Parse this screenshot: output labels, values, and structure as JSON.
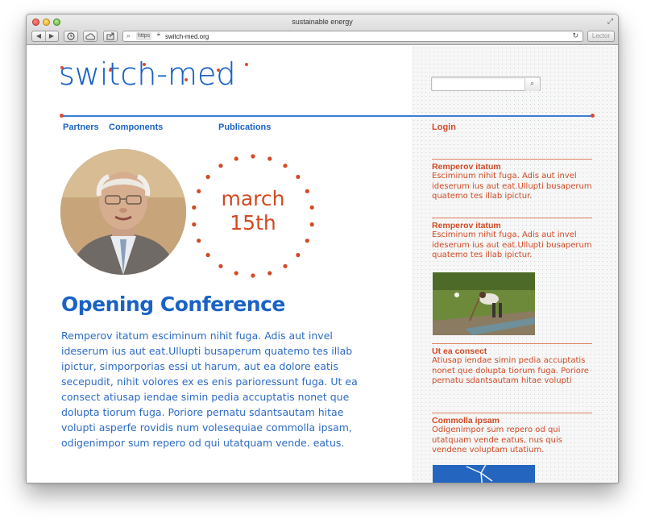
{
  "window": {
    "title": "sustainable energy"
  },
  "toolbar": {
    "back_icon": "back-arrow-icon",
    "forward_icon": "forward-arrow-icon",
    "reader_label": "Lector"
  },
  "address_bar": {
    "protocol": "https",
    "url": "switch-med.org"
  },
  "site": {
    "logo": "switch-med",
    "nav": {
      "partners": "Partners",
      "components": "Components",
      "publications": "Publications"
    },
    "login": "Login",
    "search_placeholder": ""
  },
  "event": {
    "date_line1": "march",
    "date_line2": "15th",
    "title": "Opening Conference",
    "body": "Remperov itatum esciminum nihit fuga. Adis aut invel ideserum ius aut eat.Ullupti busaperum quatemo tes illab ipictur, simporporias essi ut harum, aut ea dolore eatis secepudit, nihit volores ex es enis pariores­sunt fuga. Ut ea consect atiusap iendae simin pedia accuptatis nonet que dolupta tiorum fuga. Poriore pernatu sdantsautam hitae volupti asperfe rovidis num volesequiae commolla ipsam, odigenimpor sum repero od qui utatquam vende. eatus."
  },
  "sidebar": {
    "items": [
      {
        "title": "Remperov itatum",
        "text": "Esciminum nihit fuga. Adis aut invel ideserum ius aut eat.Ullupti busaperum quatemo tes illab ipictur."
      },
      {
        "title": "Remperov itatum",
        "text": "Esciminum nihit fuga. Adis aut invel ideserum ius aut eat.Ullupti busaperum quatemo tes illab ipictur."
      },
      {
        "title": "Ut ea consect",
        "text": "Atiusap iendae simin pedia accuptatis nonet que dolupta tiorum fuga. Poriore pernatu sdantsautam hitae volupti"
      },
      {
        "title": "Commolla ipsam",
        "text": "Odigenimpor sum repero od qui utatquam vende eatus, nus quis vendene voluptam utatium."
      }
    ]
  },
  "colors": {
    "brand_blue": "#1a63c5",
    "accent_orange": "#d24a24"
  }
}
